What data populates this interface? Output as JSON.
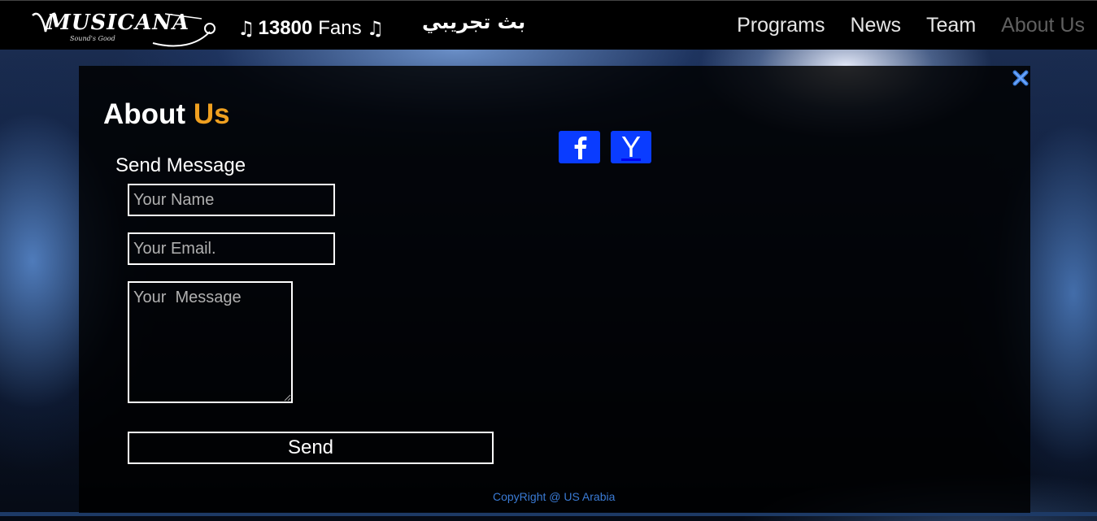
{
  "header": {
    "logo_text": "MUSICANA",
    "logo_tagline": "Sound's Good",
    "fans_count": "13800",
    "fans_label": "Fans",
    "note_symbol": "♫",
    "arabic_text": "بث تجريبي",
    "nav": [
      {
        "label": "Programs",
        "active": false
      },
      {
        "label": "News",
        "active": false
      },
      {
        "label": "Team",
        "active": false
      },
      {
        "label": "About Us",
        "active": true
      }
    ]
  },
  "modal": {
    "title_main": "About",
    "title_accent": "Us",
    "send_message_heading": "Send Message",
    "name_placeholder": "Your Name",
    "email_placeholder": "Your Email.",
    "message_placeholder": "Your  Message",
    "send_label": "Send",
    "youtube_letter": "Y",
    "copyright": "CopyRight @ US Arabia"
  },
  "colors": {
    "accent": "#f0a020",
    "social_blue": "#0a3cff",
    "close_blue": "#3a7bd5",
    "copyright_blue": "#3a7bd5"
  },
  "icons": [
    "facebook-icon",
    "youtube-icon",
    "close-icon",
    "music-note-icon"
  ]
}
